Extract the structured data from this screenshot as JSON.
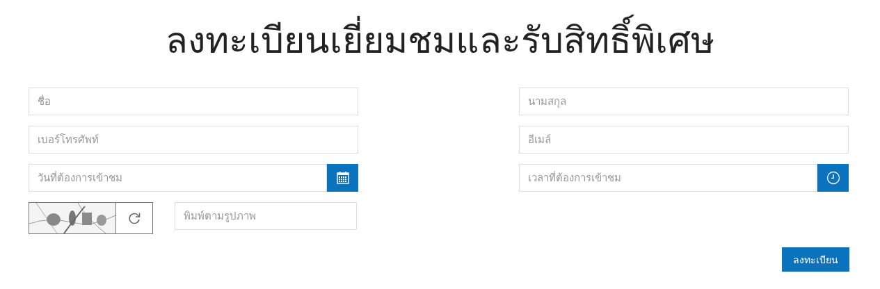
{
  "title": "ลงทะเบียนเยี่ยมชมและรับสิทธิ์พิเศษ",
  "fields": [
    {
      "kind": "text",
      "placeholder": "ชื่อ"
    },
    {
      "kind": "text",
      "placeholder": "นามสกุล"
    },
    {
      "kind": "text",
      "placeholder": "เบอร์โทรศัพท์"
    },
    {
      "kind": "text",
      "placeholder": "อีเมล์"
    },
    {
      "kind": "date",
      "placeholder": "วันที่ต้องการเข้าชม"
    },
    {
      "kind": "time",
      "placeholder": "เวลาที่ต้องการเข้าชม"
    }
  ],
  "captcha": {
    "placeholder": "พิมพ์ตามรูปภาพ"
  },
  "submit_button": "ลงทะเบียน"
}
